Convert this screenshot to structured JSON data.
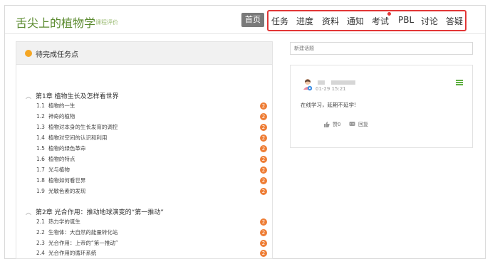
{
  "header": {
    "title": "舌尖上的植物学",
    "subtitle": "课程评价",
    "home_label": "首页",
    "nav": [
      "任务",
      "进度",
      "资料",
      "通知",
      "考试",
      "PBL",
      "讨论",
      "答疑"
    ]
  },
  "left_panel": {
    "heading": "待完成任务点",
    "chapters": [
      {
        "title": "第1章 植物生长及怎样看世界",
        "tasks": [
          {
            "num": "1.1",
            "label": "植物的一生",
            "badge": "2"
          },
          {
            "num": "1.2",
            "label": "神奇的植物",
            "badge": "2"
          },
          {
            "num": "1.3",
            "label": "植物对本身的生长发育的调控",
            "badge": "2"
          },
          {
            "num": "1.4",
            "label": "植物对空间的认识和利用",
            "badge": "2"
          },
          {
            "num": "1.5",
            "label": "植物的绿色革命",
            "badge": "2"
          },
          {
            "num": "1.6",
            "label": "植物的特点",
            "badge": "2"
          },
          {
            "num": "1.7",
            "label": "光与植物",
            "badge": "2"
          },
          {
            "num": "1.8",
            "label": "植物如何看世界",
            "badge": "2"
          },
          {
            "num": "1.9",
            "label": "光敏色素的发现",
            "badge": "2"
          }
        ]
      },
      {
        "title": "第2章 光合作用：推动地球演变的“第一推动”",
        "tasks": [
          {
            "num": "2.1",
            "label": "热力学的诞生",
            "badge": "2"
          },
          {
            "num": "2.2",
            "label": "生物体：大自然的能量转化站",
            "badge": "2"
          },
          {
            "num": "2.3",
            "label": "光合作用：上帝的“第一推动”",
            "badge": "2"
          },
          {
            "num": "2.4",
            "label": "光合作用的循环系统",
            "badge": "2"
          }
        ]
      }
    ]
  },
  "discussion": {
    "new_topic_placeholder": "新建话题",
    "post": {
      "time": "01-29 15:21",
      "text": "在线学习，延期不延学!",
      "like_label": "赞0",
      "reply_label": "回复"
    }
  },
  "colors": {
    "accent_green": "#5a8a2e",
    "highlight_red": "#e23636",
    "badge_orange": "#ee7d35",
    "dot_orange": "#f5a623"
  },
  "icons": [
    "user-avatar-icon",
    "menu-icon",
    "like-icon",
    "reply-icon",
    "caret-icon"
  ]
}
